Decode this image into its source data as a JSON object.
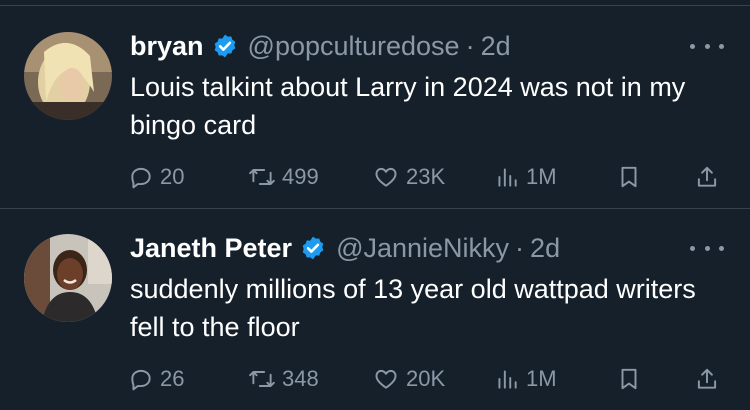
{
  "tweets": [
    {
      "name": "bryan",
      "handle": "@popculturedose",
      "separator": "·",
      "time": "2d",
      "text": "Louis talkint about Larry in 2024 was not in my bingo card",
      "replies": "20",
      "retweets": "499",
      "likes": "23K",
      "views": "1M"
    },
    {
      "name": "Janeth Peter",
      "handle": "@JannieNikky",
      "separator": "·",
      "time": "2d",
      "text": "suddenly millions of 13 year old wattpad writers fell to the floor",
      "replies": "26",
      "retweets": "348",
      "likes": "20K",
      "views": "1M"
    }
  ],
  "colors": {
    "background": "#15202b",
    "muted": "#8b98a5",
    "verified": "#1d9bf0",
    "divider": "#38444d"
  },
  "icons": [
    "verified-badge-icon",
    "more-icon",
    "reply-icon",
    "retweet-icon",
    "like-icon",
    "views-icon",
    "bookmark-icon",
    "share-icon"
  ]
}
